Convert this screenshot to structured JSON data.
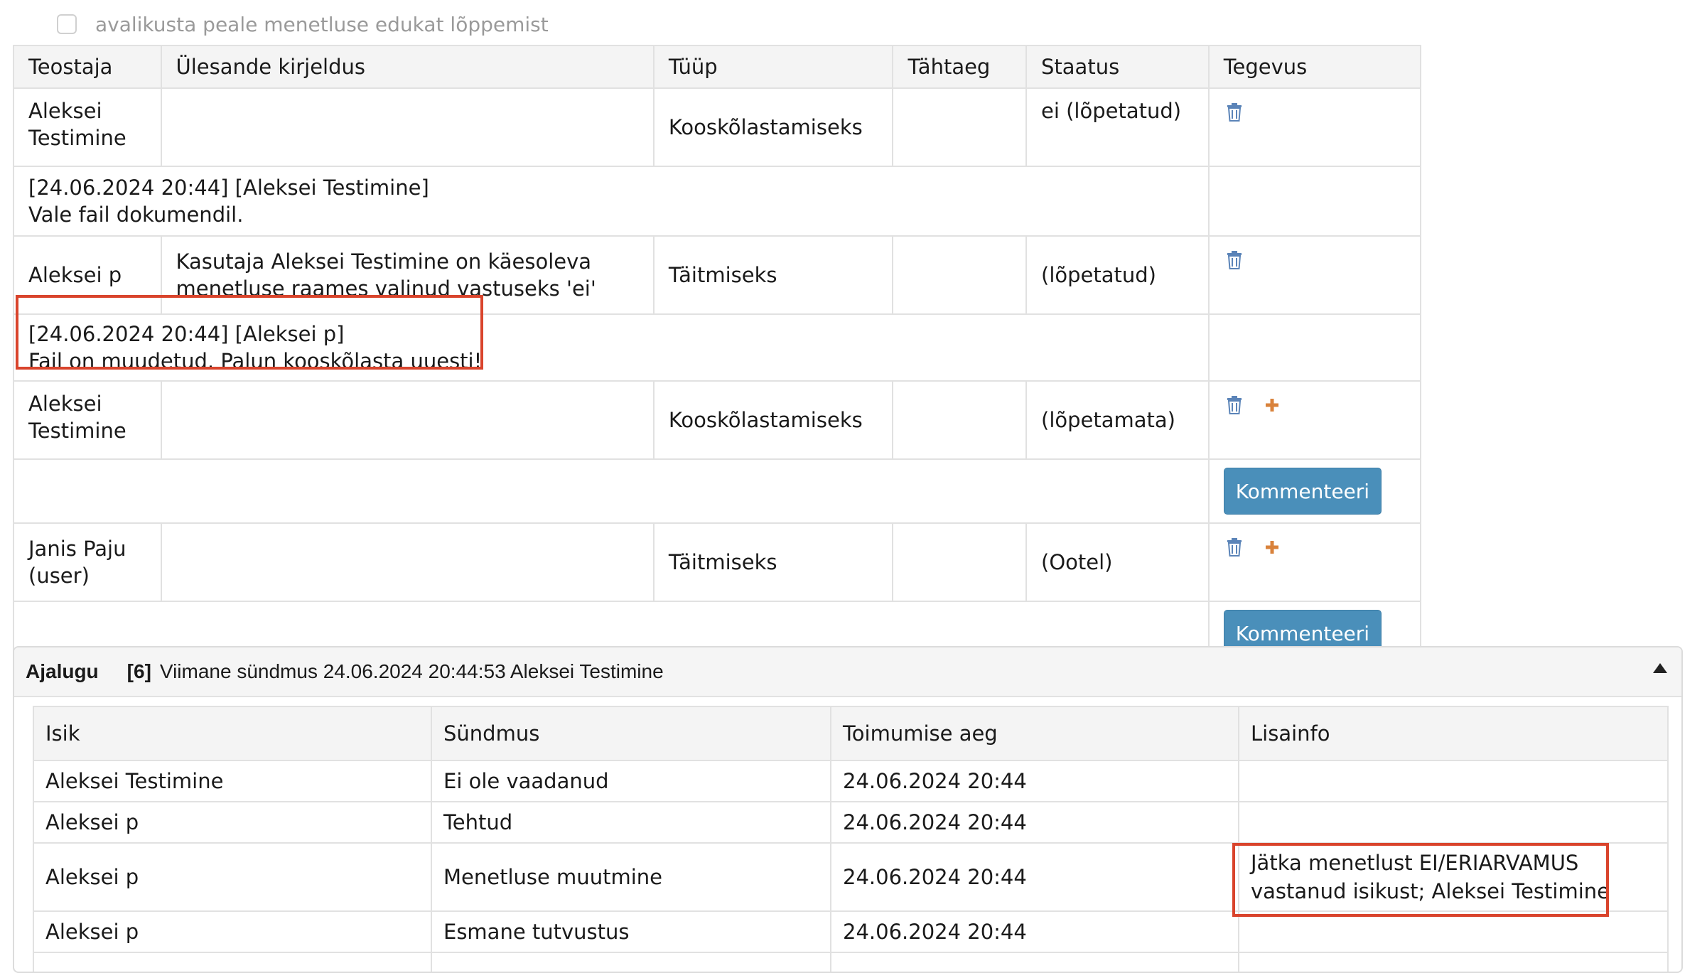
{
  "checkbox": {
    "label": "avalikusta peale menetluse edukat lõppemist"
  },
  "tasks": {
    "headers": [
      "Teostaja",
      "Ülesande kirjeldus",
      "Tüüp",
      "Tähtaeg",
      "Staatus",
      "Tegevus"
    ],
    "rows": [
      {
        "performer": "Aleksei Testimine",
        "description": "",
        "type": "Kooskõlastamiseks",
        "deadline": "",
        "status": "ei (lõpetatud)"
      },
      {
        "comment_line1": "[24.06.2024 20:44] [Aleksei Testimine]",
        "comment_line2": "Vale fail dokumendil."
      },
      {
        "performer": "Aleksei p",
        "description_line1": "Kasutaja Aleksei Testimine on käesoleva",
        "description_line2": "menetluse raames valinud vastuseks 'ei'",
        "type": "Täitmiseks",
        "deadline": "",
        "status": "(lõpetatud)"
      },
      {
        "comment_line1": "[24.06.2024 20:44] [Aleksei p]",
        "comment_line2": "Fail on muudetud. Palun kooskõlasta uuesti!"
      },
      {
        "performer": "Aleksei Testimine",
        "description": "",
        "type": "Kooskõlastamiseks",
        "deadline": "",
        "status": "(lõpetamata)"
      },
      {
        "button": "Kommenteeri"
      },
      {
        "performer": "Janis Paju (user)",
        "description": "",
        "type": "Täitmiseks",
        "deadline": "",
        "status": "(Ootel)"
      },
      {
        "button": "Kommenteeri"
      }
    ]
  },
  "history": {
    "title": "Ajalugu",
    "count": "[6]",
    "last_event": "Viimane sündmus 24.06.2024 20:44:53 Aleksei Testimine",
    "headers": [
      "Isik",
      "Sündmus",
      "Toimumise aeg",
      "Lisainfo"
    ],
    "rows": [
      {
        "person": "Aleksei Testimine",
        "event": "Ei ole vaadanud",
        "time": "24.06.2024 20:44",
        "info": ""
      },
      {
        "person": "Aleksei p",
        "event": "Tehtud",
        "time": "24.06.2024 20:44",
        "info": ""
      },
      {
        "person": "Aleksei p",
        "event": "Menetluse muutmine",
        "time": "24.06.2024 20:44",
        "info_line1": "Jätka menetlust EI/ERIARVAMUS",
        "info_line2": "vastanud isikust; Aleksei Testimine"
      },
      {
        "person": "Aleksei p",
        "event": "Esmane tutvustus",
        "time": "24.06.2024 20:44",
        "info": ""
      }
    ]
  },
  "colors": {
    "button": "#4a8fba",
    "highlight": "#d9442c",
    "trash": "#5b84b8",
    "plus": "#d9823b"
  },
  "icons": {
    "delete": "trash-icon",
    "add": "plus-icon",
    "collapse": "caret-up-icon"
  }
}
